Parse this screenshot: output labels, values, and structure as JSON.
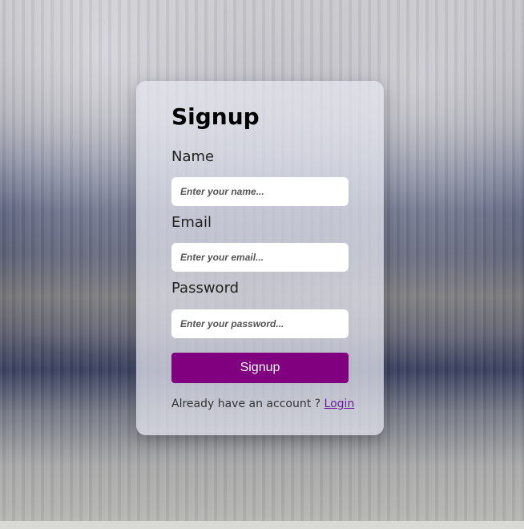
{
  "form": {
    "title": "Signup",
    "name_label": "Name",
    "name_placeholder": "Enter your name...",
    "email_label": "Email",
    "email_placeholder": "Enter your email...",
    "password_label": "Password",
    "password_placeholder": "Enter your password...",
    "submit_label": "Signup",
    "footer_text": "Already have an account ? ",
    "login_link": "Login"
  },
  "colors": {
    "button": "#800080",
    "link": "#6a1b9a"
  }
}
